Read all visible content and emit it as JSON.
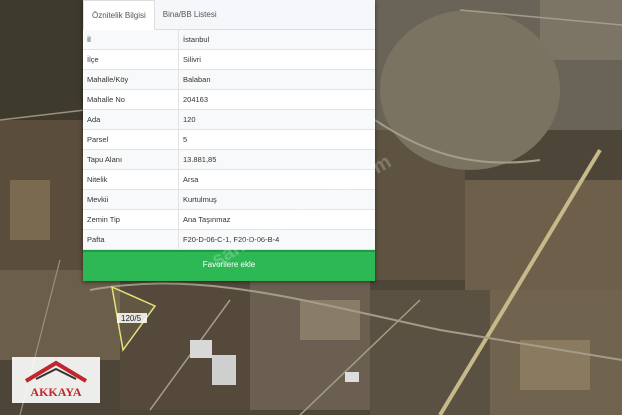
{
  "tabs": [
    {
      "label": "Öznitelik Bilgisi"
    },
    {
      "label": "Bina/BB Listesi"
    }
  ],
  "attributes": [
    {
      "key": "İl",
      "value": "İstanbul"
    },
    {
      "key": "İlçe",
      "value": "Silivri"
    },
    {
      "key": "Mahalle/Köy",
      "value": "Balaban"
    },
    {
      "key": "Mahalle No",
      "value": "204163"
    },
    {
      "key": "Ada",
      "value": "120"
    },
    {
      "key": "Parsel",
      "value": "5"
    },
    {
      "key": "Tapu Alanı",
      "value": "13.881,85"
    },
    {
      "key": "Nitelik",
      "value": "Arsa"
    },
    {
      "key": "Mevkii",
      "value": "Kurtulmuş"
    },
    {
      "key": "Zemin Tip",
      "value": "Ana Taşınmaz"
    },
    {
      "key": "Pafta",
      "value": "F20-D-06-C-1, F20-D-06-B-4"
    }
  ],
  "favorite_button": "Favorilere ekle",
  "map": {
    "parcel_label": "120/5"
  },
  "logo": {
    "text": "AKKAYA"
  },
  "watermark": "sahibindenlakjet.com"
}
